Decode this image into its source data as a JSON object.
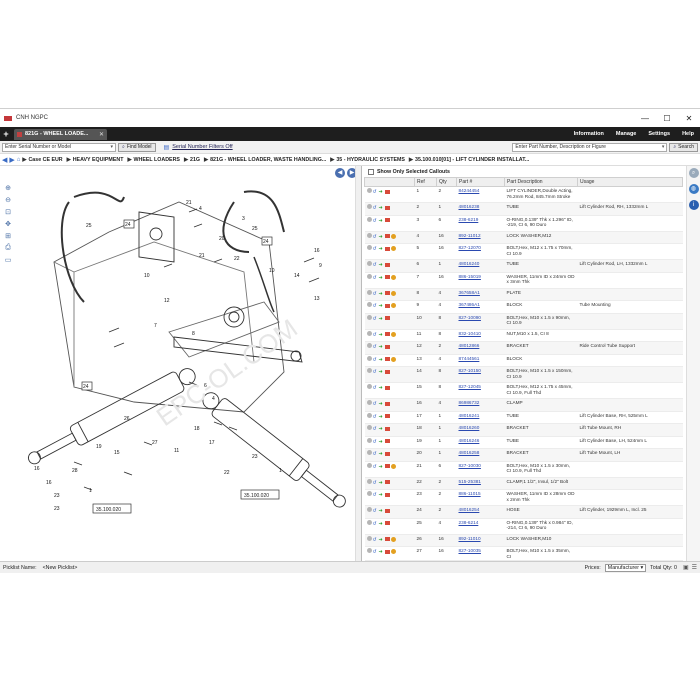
{
  "window": {
    "title": "CNH NGPC",
    "controls": [
      "—",
      "☐",
      "✕"
    ]
  },
  "tabbar": {
    "tab_label": "821G - WHEEL LOADE...",
    "menu": [
      "Information",
      "Manage",
      "Settings",
      "Help"
    ]
  },
  "search": {
    "serial_placeholder": "Enter Serial Number or Model",
    "find_model": "Find Model",
    "serial_filters": "Serial Number Filters Off",
    "part_placeholder": "Enter Part Number, Description or Figure",
    "search_btn": "Search"
  },
  "breadcrumb": [
    "Case CE EUR",
    "HEAVY EQUIPMENT",
    "WHEEL LOADERS",
    "21G",
    "821G - WHEEL LOADER, WASTE HANDLING...",
    "35 - HYDRAULIC SYSTEMS",
    "35.100.010[01] - LIFT CYLINDER INSTALLAT..."
  ],
  "diagram": {
    "watermark": "EPC-OL.COM",
    "callouts": [
      "1",
      "2",
      "3",
      "4",
      "5",
      "6",
      "7",
      "8",
      "9",
      "10",
      "11",
      "12",
      "13",
      "14",
      "15",
      "16",
      "17",
      "18",
      "19",
      "20",
      "21",
      "22",
      "23",
      "24",
      "25",
      "26",
      "27",
      "28"
    ],
    "refs": [
      "35.100.020",
      "35.100.020",
      "24",
      "24",
      "24"
    ]
  },
  "parts_list": {
    "show_only_label": "Show Only Selected Callouts",
    "columns": [
      "Ref",
      "Qty",
      "Part #",
      "Part Description",
      "Usage"
    ],
    "rows": [
      {
        "ref": "1",
        "qty": "2",
        "part": "84244454",
        "desc": "LIFT CYLINDER,Double Acting, 76.2mm Rod, 845.7mm Stroke",
        "usage": "",
        "tall": true,
        "gold": false
      },
      {
        "ref": "2",
        "qty": "1",
        "part": "48016238",
        "desc": "TUBE",
        "usage": "Lift Cylinder Rod, RH, 1332mm L",
        "tall": false,
        "gold": false
      },
      {
        "ref": "3",
        "qty": "6",
        "part": "238-6219",
        "desc": "O-RING,0.139\" Thk x 1.296\" ID, -219, CI 6, 90 Duro",
        "usage": "",
        "tall": true,
        "gold": false
      },
      {
        "ref": "4",
        "qty": "16",
        "part": "892-11012",
        "desc": "LOCK WASHER,M12",
        "usage": "",
        "tall": false,
        "gold": true
      },
      {
        "ref": "5",
        "qty": "16",
        "part": "827-12070",
        "desc": "BOLT,Hex, M12 x 1.75 x 70mm, CI 10.9",
        "usage": "",
        "tall": true,
        "gold": true
      },
      {
        "ref": "6",
        "qty": "1",
        "part": "48016240",
        "desc": "TUBE",
        "usage": "Lift Cylinder Rod, LH, 1332mm L",
        "tall": false,
        "gold": false
      },
      {
        "ref": "7",
        "qty": "16",
        "part": "886-15019",
        "desc": "WASHER, 11mm ID x 24mm OD x 3mm Thk",
        "usage": "",
        "tall": true,
        "gold": true
      },
      {
        "ref": "8",
        "qty": "4",
        "part": "367658A1",
        "desc": "PLATE",
        "usage": "",
        "tall": false,
        "gold": true
      },
      {
        "ref": "9",
        "qty": "4",
        "part": "367486A1",
        "desc": "BLOCK",
        "usage": "Tube Mounting",
        "tall": false,
        "gold": true
      },
      {
        "ref": "10",
        "qty": "8",
        "part": "827-10090",
        "desc": "BOLT,Hex, M10 x 1.5 x 90mm, CI 10.9",
        "usage": "",
        "tall": true,
        "gold": false
      },
      {
        "ref": "11",
        "qty": "8",
        "part": "832-10410",
        "desc": "NUT,M10 x 1.5, CI 8",
        "usage": "",
        "tall": false,
        "gold": true
      },
      {
        "ref": "12",
        "qty": "2",
        "part": "48012866",
        "desc": "BRACKET",
        "usage": "Ride Control Tube Support",
        "tall": false,
        "gold": false
      },
      {
        "ref": "13",
        "qty": "4",
        "part": "87444561",
        "desc": "BLOCK",
        "usage": "",
        "tall": false,
        "gold": true
      },
      {
        "ref": "14",
        "qty": "8",
        "part": "827-10150",
        "desc": "BOLT,Hex, M10 x 1.5 x 150mm, CI 10.9",
        "usage": "",
        "tall": true,
        "gold": false
      },
      {
        "ref": "15",
        "qty": "8",
        "part": "827-12045",
        "desc": "BOLT,Hex, M12 x 1.75 x 45mm, CI 10.9, Full Thd",
        "usage": "",
        "tall": true,
        "gold": false
      },
      {
        "ref": "16",
        "qty": "4",
        "part": "86986732",
        "desc": "CLAMP",
        "usage": "",
        "tall": false,
        "gold": false
      },
      {
        "ref": "17",
        "qty": "1",
        "part": "48016241",
        "desc": "TUBE",
        "usage": "Lift Cylinder Base, RH, 525mm L",
        "tall": false,
        "gold": false
      },
      {
        "ref": "18",
        "qty": "1",
        "part": "48016260",
        "desc": "BRACKET",
        "usage": "Lift Tube Mount, RH",
        "tall": false,
        "gold": false
      },
      {
        "ref": "19",
        "qty": "1",
        "part": "48016246",
        "desc": "TUBE",
        "usage": "Lift Cylinder Base, LH, 524mm L",
        "tall": false,
        "gold": false
      },
      {
        "ref": "20",
        "qty": "1",
        "part": "48016258",
        "desc": "BRACKET",
        "usage": "Lift Tube Mount, LH",
        "tall": false,
        "gold": false
      },
      {
        "ref": "21",
        "qty": "6",
        "part": "827-10030",
        "desc": "BOLT,Hex, M10 x 1.5 x 30mm, CI 10.9, Full Thd",
        "usage": "",
        "tall": true,
        "gold": true
      },
      {
        "ref": "22",
        "qty": "2",
        "part": "515-25381",
        "desc": "CLAMP,1 1/2\", Insul, 1/2\" Bolt",
        "usage": "",
        "tall": false,
        "gold": false
      },
      {
        "ref": "23",
        "qty": "2",
        "part": "886-11015",
        "desc": "WASHER, 11mm ID x 28mm OD x 2mm Thk",
        "usage": "",
        "tall": true,
        "gold": false
      },
      {
        "ref": "24",
        "qty": "2",
        "part": "48016254",
        "desc": "HOSE",
        "usage": "Lift Cylinder, 1929mm L, Incl. 25",
        "tall": false,
        "gold": false
      },
      {
        "ref": "25",
        "qty": "4",
        "part": "238-6214",
        "desc": "O-RING,0.139\" Thk x 0.984\" ID, -214, CI 6, 90 Duro",
        "usage": "",
        "tall": true,
        "gold": false
      },
      {
        "ref": "26",
        "qty": "16",
        "part": "892-11010",
        "desc": "LOCK WASHER,M10",
        "usage": "",
        "tall": false,
        "gold": true
      },
      {
        "ref": "27",
        "qty": "16",
        "part": "827-10035",
        "desc": "BOLT,Hex, M10 x 1.5 x 35mm, CI",
        "usage": "",
        "tall": false,
        "gold": true
      }
    ]
  },
  "statusbar": {
    "picklist_label": "Picklist Name:",
    "picklist_value": "<New Picklist>",
    "prices_label": "Prices:",
    "prices_value": "Manufacturer",
    "total_qty": "Total Qty: 0"
  },
  "colors": {
    "tabbar": "#1e1e1e",
    "accent": "#3a67c7",
    "link": "#2a49b0"
  }
}
